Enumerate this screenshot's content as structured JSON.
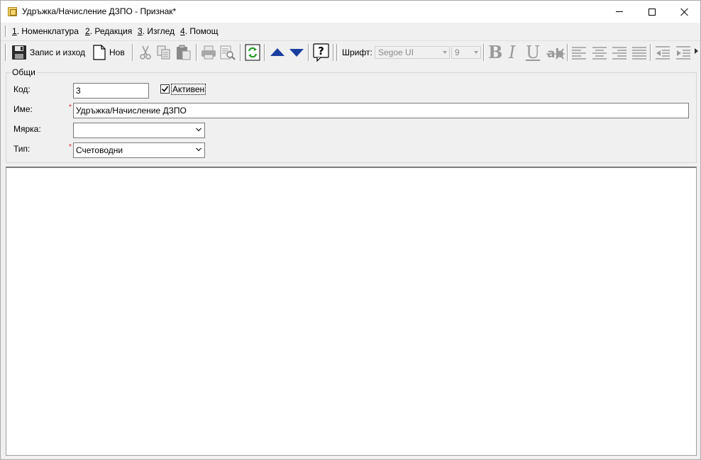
{
  "window": {
    "title": "Удръжка/Начисление ДЗПО - Признак*"
  },
  "menu": [
    {
      "num": "1",
      "label": ". Номенклатура"
    },
    {
      "num": "2",
      "label": ". Редакция"
    },
    {
      "num": "3",
      "label": ". Изглед"
    },
    {
      "num": "4",
      "label": ". Помощ"
    }
  ],
  "toolbar": {
    "save_exit_label": "Запис и изход",
    "new_label": "Нов",
    "font_label": "Шрифт:",
    "font_value": "Segoe UI",
    "size_value": "9",
    "icons": [
      "save-icon",
      "new-document-icon",
      "cut-icon",
      "copy-icon",
      "paste-icon",
      "print-icon",
      "print-preview-icon",
      "refresh-icon",
      "arrow-up-icon",
      "arrow-down-icon",
      "help-icon",
      "bold-icon",
      "italic-icon",
      "underline-icon",
      "strikethrough-icon",
      "align-left-icon",
      "align-center-icon",
      "align-right-icon",
      "justify-icon",
      "outdent-icon",
      "indent-icon"
    ]
  },
  "form": {
    "group_title": "Общи",
    "code": {
      "label": "Код:",
      "value": "3"
    },
    "active": {
      "label": "Активен",
      "checked": true
    },
    "name": {
      "label": "Име:",
      "value": "Удръжка/Начисление ДЗПО",
      "required_mark": "*"
    },
    "unit": {
      "label": "Мярка:",
      "value": ""
    },
    "type": {
      "label": "Тип:",
      "value": "Счетоводни",
      "required_mark": "*"
    }
  },
  "colors": {
    "required": "#d02020",
    "arrow_blue": "#1a3fa0",
    "refresh_green": "#2a9a2a"
  }
}
